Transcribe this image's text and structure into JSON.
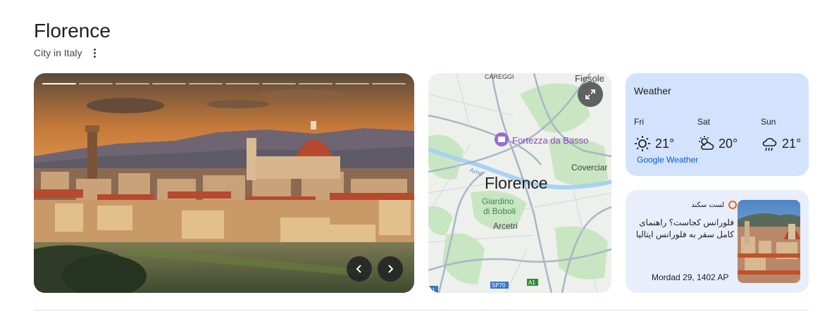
{
  "header": {
    "title": "Florence",
    "subtitle": "City in Italy",
    "more_icon": "more-vert-icon"
  },
  "photo_carousel": {
    "slide_count": 10,
    "active_slide": 1,
    "prev_icon": "chevron-left-icon",
    "next_icon": "chevron-right-icon"
  },
  "map": {
    "expand_icon": "expand-icon",
    "labels": {
      "careggi": "CAREGGI",
      "fiesole": "Fiesole",
      "fortezza": "Fortezza da Basso",
      "coverciano": "Coverciar",
      "florence": "Florence",
      "giardino": "Giardino",
      "boboli": "di Boboli",
      "arcetri": "Arcetri",
      "arno": "Arno",
      "sp70": "SP70",
      "a1": "A1",
      "a11": "A1"
    },
    "poi_icon": "museum-icon"
  },
  "weather": {
    "title": "Weather",
    "days": [
      {
        "day": "Fri",
        "temp": "21°",
        "icon": "sunny-icon"
      },
      {
        "day": "Sat",
        "temp": "20°",
        "icon": "partly-cloudy-icon"
      },
      {
        "day": "Sun",
        "temp": "21°",
        "icon": "rain-icon"
      }
    ],
    "source": "Google Weather"
  },
  "article": {
    "source": "لست سکند",
    "headline": "فلورانس کجاست؟ راهنمای کامل سفر به فلورانس ایتالیا",
    "date": "Mordad 29, 1402 AP",
    "source_logo": "site-logo-icon"
  },
  "colors": {
    "weather_bg": "#d3e3fd",
    "article_bg": "#e8eefb",
    "link": "#0b57d0",
    "map_bg": "#eef0ec",
    "road": "#a9b6c6",
    "park": "#c8e6c1"
  }
}
